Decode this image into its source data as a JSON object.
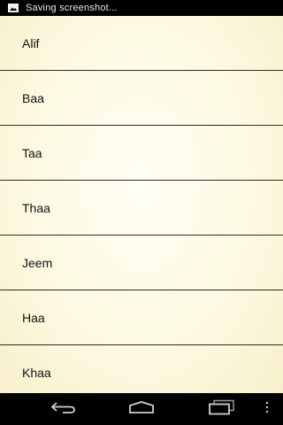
{
  "status_bar": {
    "notification_icon": "image-icon",
    "text": "Saving screenshot..."
  },
  "list": {
    "items": [
      {
        "label": "Alif"
      },
      {
        "label": "Baa"
      },
      {
        "label": "Taa"
      },
      {
        "label": "Thaa"
      },
      {
        "label": "Jeem"
      },
      {
        "label": "Haa"
      },
      {
        "label": "Khaa"
      }
    ]
  },
  "nav_bar": {
    "back_icon": "back-arrow-icon",
    "home_icon": "home-icon",
    "recents_icon": "recent-apps-icon",
    "menu_icon": "overflow-menu-icon"
  },
  "colors": {
    "list_background": "#fdf9e2",
    "divider": "#2d2d2d",
    "bars": "#000000"
  }
}
